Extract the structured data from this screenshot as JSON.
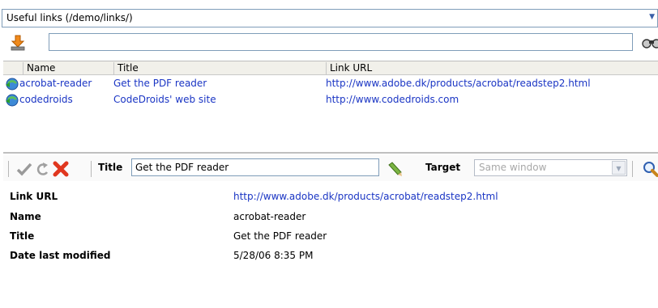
{
  "folder_select": {
    "value": "Useful links (/demo/links/)"
  },
  "search": {
    "value": ""
  },
  "list": {
    "columns": [
      "Name",
      "Title",
      "Link URL"
    ],
    "rows": [
      {
        "name": "acrobat-reader",
        "title": "Get the PDF reader",
        "url": "http://www.adobe.dk/products/acrobat/readstep2.html"
      },
      {
        "name": "codedroids",
        "title": "CodeDroids' web site",
        "url": "http://www.codedroids.com"
      }
    ]
  },
  "toolbar": {
    "title_label": "Title",
    "title_value": "Get the PDF reader",
    "target_label": "Target",
    "target_value": "Same window"
  },
  "details": [
    {
      "label": "Link URL",
      "value": "http://www.adobe.dk/products/acrobat/readstep2.html"
    },
    {
      "label": "Name",
      "value": "acrobat-reader"
    },
    {
      "label": "Title",
      "value": "Get the PDF reader"
    },
    {
      "label": "Date last modified",
      "value": "5/28/06 8:35 PM"
    }
  ],
  "icons": {
    "download": "download-icon",
    "search": "binoculars-icon",
    "link": "link-icon",
    "save": "checkmark-icon",
    "revert": "revert-icon",
    "delete": "delete-icon",
    "edit": "pencil-icon",
    "find": "magnifier-icon"
  },
  "colors": {
    "link": "#1a35c4",
    "border": "#7f9db9",
    "header_bg": "#f1f0ea"
  }
}
